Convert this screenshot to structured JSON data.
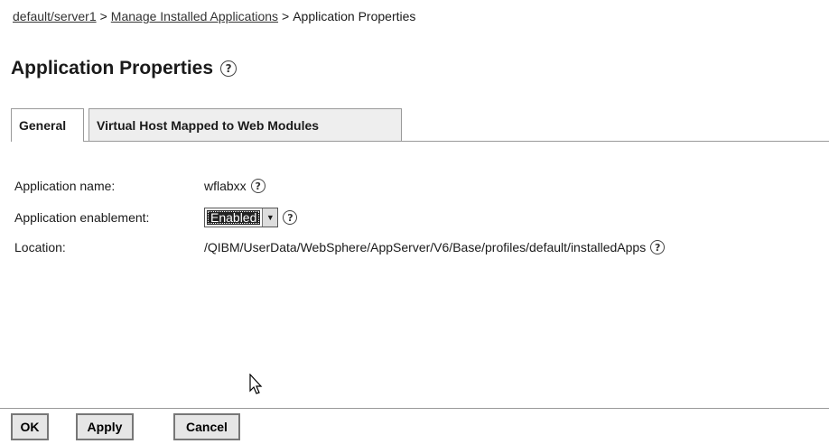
{
  "breadcrumb": {
    "items": [
      "default/server1",
      "Manage Installed Applications",
      "Application Properties"
    ],
    "separator": ">"
  },
  "page_title": "Application Properties",
  "tabs": [
    {
      "label": "General",
      "active": true
    },
    {
      "label": "Virtual Host Mapped to Web Modules",
      "active": false
    }
  ],
  "fields": {
    "app_name": {
      "label": "Application name:",
      "value": "wflabxx"
    },
    "enablement": {
      "label": "Application enablement:",
      "selected": "Enabled"
    },
    "location": {
      "label": "Location:",
      "value": "/QIBM/UserData/WebSphere/AppServer/V6/Base/profiles/default/installedApps"
    }
  },
  "buttons": {
    "ok": "OK",
    "apply": "Apply",
    "cancel": "Cancel"
  },
  "icons": {
    "help": "help-icon",
    "dropdown": "chevron-down-icon",
    "cursor": "mouse-pointer-icon"
  }
}
